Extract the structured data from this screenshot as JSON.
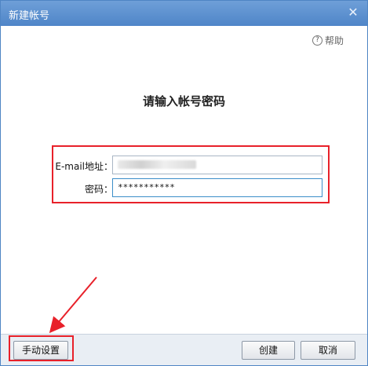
{
  "window": {
    "title": "新建帐号",
    "close_glyph": "✕"
  },
  "help": {
    "icon": "?",
    "label": "帮助"
  },
  "heading": "请输入帐号密码",
  "form": {
    "email_label": "E-mail地址：",
    "email_value": "",
    "password_label": "密码：",
    "password_value": "***********"
  },
  "footer": {
    "manual_label": "手动设置",
    "create_label": "创建",
    "cancel_label": "取消"
  },
  "colors": {
    "titlebar": "#4f85c8",
    "annotation_red": "#e8212a",
    "footer_bg": "#e9eef4"
  }
}
